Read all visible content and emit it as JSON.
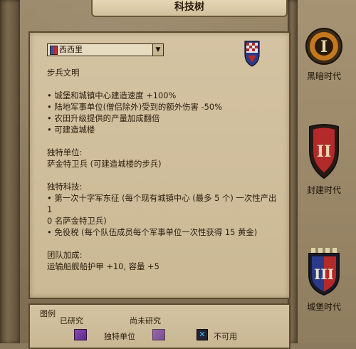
{
  "window": {
    "title": "科技树"
  },
  "civ_select": {
    "value": "西西里",
    "arrow": "▼"
  },
  "civ_info": {
    "civ_type": "步兵文明",
    "bonuses": [
      "• 城堡和城镇中心建造速度 +100%",
      "• 陆地军事单位(僧侣除外)受到的额外伤害 -50%",
      "• 农田升级提供的产量加成翻倍",
      "• 可建造城楼"
    ],
    "unique_unit_heading": "独特单位:",
    "unique_unit_text": "萨金特卫兵 (可建造城楼的步兵)",
    "unique_tech_heading": "独特科技:",
    "unique_tech_1_line1": "• 第一次十字军东征 (每个现有城镇中心 (最多 5 个) 一次性产出 1",
    "unique_tech_1_line2": "0 名萨金特卫兵)",
    "unique_tech_2": "• 免役税 (每个队伍成员每个军事单位一次性获得 15 黄金)",
    "team_bonus_heading": "团队加成:",
    "team_bonus_text": "运输船舰船护甲 +10, 容量 +5"
  },
  "legend": {
    "title": "图例",
    "researched": "已研究",
    "not_researched": "尚未研究",
    "unique_unit": "独特单位",
    "unavailable": "不可用",
    "unavailable_mark": "✕"
  },
  "ages": [
    {
      "numeral": "I",
      "label": "黑暗时代"
    },
    {
      "numeral": "II",
      "label": "封建时代"
    },
    {
      "numeral": "III",
      "label": "城堡时代"
    }
  ],
  "colors": {
    "unique_unit_swatch": "#8a4ab6",
    "shield_red": "#b32a2a",
    "shield_blue": "#2a3a8a",
    "dark_age_orange": "#c4781e"
  }
}
